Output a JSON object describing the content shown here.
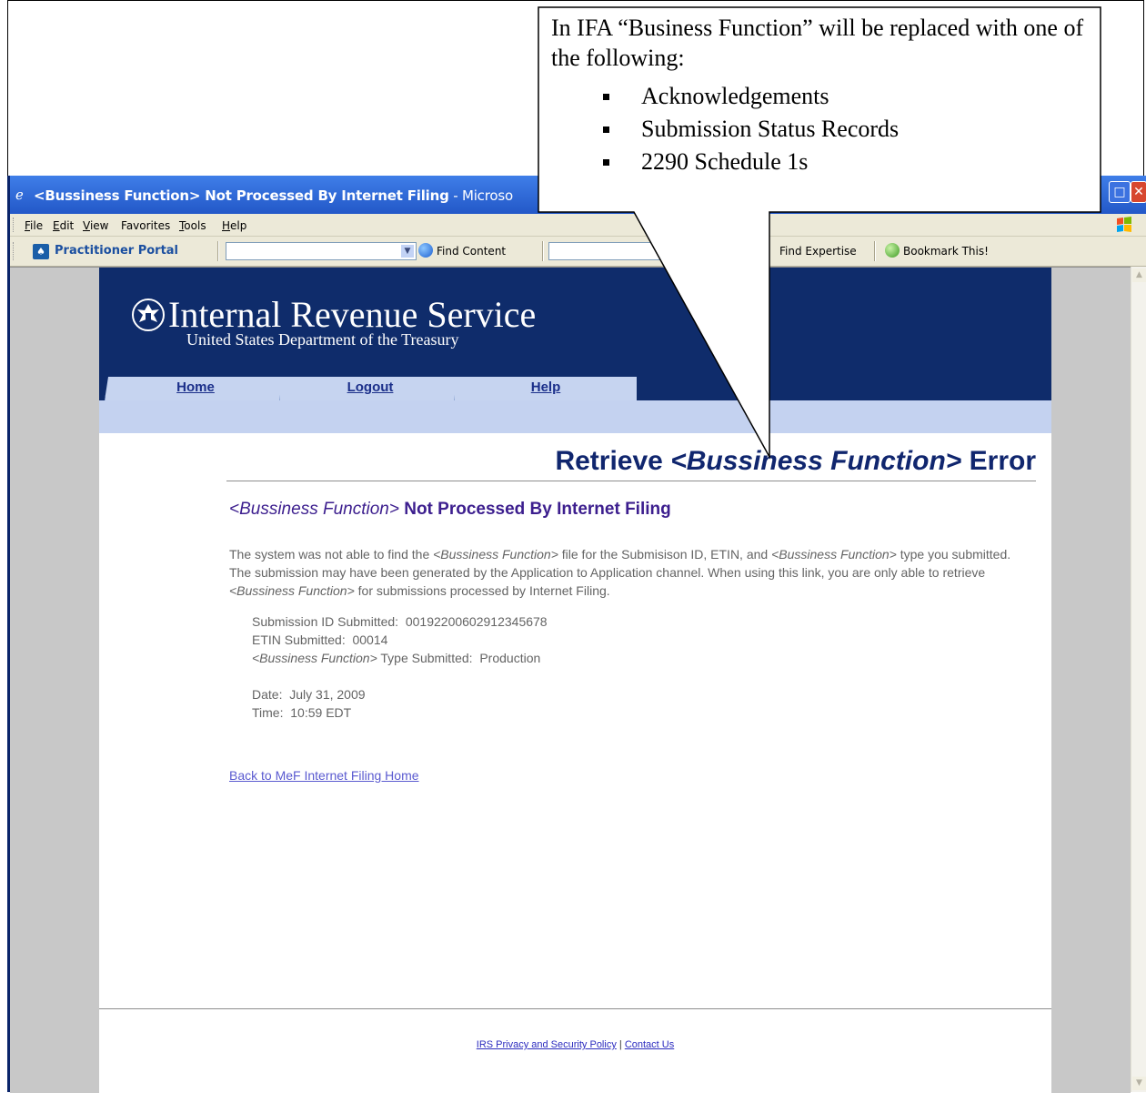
{
  "window": {
    "title_bold": "<Bussiness Function> Not Processed By Internet Filing",
    "title_rest": " - Microso"
  },
  "menu": {
    "items": [
      {
        "key": "F",
        "rest": "ile"
      },
      {
        "key": "E",
        "rest": "dit"
      },
      {
        "key": "V",
        "rest": "iew"
      },
      {
        "key": "F",
        "prefix": "",
        "rest": "avorites",
        "display_key_index": 1
      },
      {
        "key": "T",
        "rest": "ools"
      },
      {
        "key": "H",
        "rest": "elp"
      }
    ]
  },
  "toolbar": {
    "portal_label": "Practitioner Portal",
    "find_content": "Find Content",
    "find_expertise": "Find Expertise",
    "bookmark": "Bookmark This!"
  },
  "irs": {
    "title": "Internal Revenue Service",
    "subtitle": "United States Department of the Treasury",
    "tabs": [
      "Home",
      "Logout",
      "Help"
    ]
  },
  "error": {
    "title_prefix": "Retrieve ",
    "title_func": "<Bussiness Function>",
    "title_suffix": " Error",
    "subtitle_func": "<Bussiness Function>",
    "subtitle_rest": " Not Processed By Internet Filing",
    "body_1": "The system was not able to find the ",
    "body_func_1": "<Bussiness Function>",
    "body_2": " file for the Submisison ID, ETIN, and ",
    "body_func_2": "<Bussiness Function>",
    "body_3": " type you submitted. The submission may have been generated by the Application to Application channel. When using this link, you are only able to retrieve ",
    "body_func_3": "<Bussiness Function>",
    "body_4": " for submissions processed by Internet Filing.",
    "submission_id_label": "Submission ID Submitted:",
    "submission_id_value": "00192200602912345678",
    "etin_label": "ETIN Submitted:",
    "etin_value": "00014",
    "type_func": "<Bussiness Function>",
    "type_label": " Type Submitted:",
    "type_value": "Production",
    "date_label": "Date:",
    "date_value": "July 31, 2009",
    "time_label": "Time:",
    "time_value": "10:59 EDT",
    "back_link": "Back to MeF Internet Filing Home"
  },
  "footer": {
    "privacy_link": "IRS Privacy and Security Policy",
    "separator": " | ",
    "contact_link": "Contact Us"
  },
  "callout": {
    "intro": "In IFA “Business Function” will be replaced with one of the following:",
    "items": [
      "Acknowledgements",
      "Submission Status Records",
      "2290 Schedule 1s"
    ]
  }
}
